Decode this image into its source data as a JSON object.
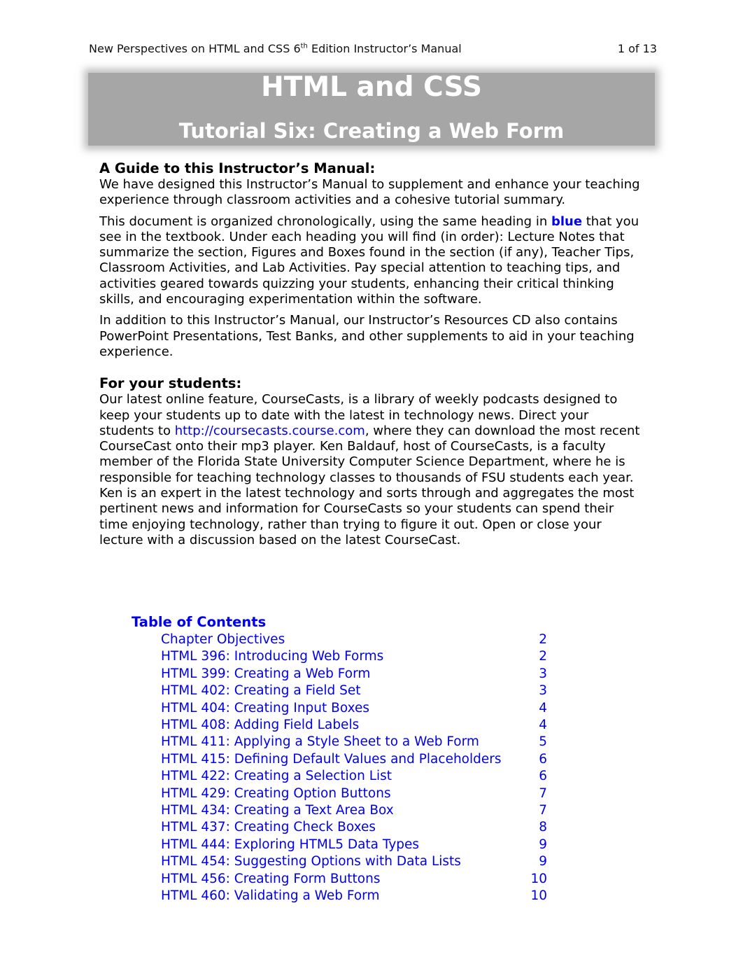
{
  "header": {
    "title_prefix": "New Perspectives on HTML and CSS 6",
    "title_sup": "th",
    "title_suffix": " Edition Instructor’s Manual",
    "page_indicator": "1 of 13"
  },
  "banner": {
    "title": "HTML and CSS",
    "subtitle": "Tutorial Six: Creating a Web Form"
  },
  "guide": {
    "heading": "A Guide to this Instructor’s Manual:",
    "para1": "We have designed this Instructor’s Manual to supplement and enhance your teaching experience through classroom activities and a cohesive tutorial summary.",
    "para2_before": "This document is organized chronologically, using the same heading in ",
    "para2_highlight": "blue",
    "para2_after": " that you see in the textbook. Under each heading you will find (in order): Lecture Notes that summarize the section, Figures and Boxes found in the section (if any), Teacher Tips, Classroom Activities, and Lab Activities. Pay special attention to teaching tips, and activities geared towards quizzing your students, enhancing their critical thinking skills, and encouraging experimentation within the software.",
    "para3": "In addition to this Instructor’s Manual, our Instructor’s Resources CD also contains PowerPoint Presentations, Test Banks, and other supplements to aid in your teaching experience."
  },
  "students": {
    "heading": "For your students:",
    "para_before": "Our latest online feature, CourseCasts, is a library of weekly podcasts designed to keep your students up to date with the latest in technology news. Direct your students to ",
    "link": "http://coursecasts.course.com",
    "para_after": ", where they can download the most recent CourseCast onto their mp3 player. Ken Baldauf, host of CourseCasts, is a faculty member of the Florida State University Computer Science Department, where he is responsible for teaching technology classes to thousands of FSU students each year. Ken is an expert in the latest technology and sorts through and aggregates the most pertinent news and information for CourseCasts so your students can spend their time enjoying technology, rather than trying to figure it out. Open or close your lecture with a discussion based on the latest CourseCast."
  },
  "toc": {
    "title": "Table of Contents",
    "items": [
      {
        "label": "Chapter Objectives",
        "page": "2"
      },
      {
        "label": "HTML 396: Introducing Web Forms",
        "page": "2"
      },
      {
        "label": "HTML 399: Creating a Web Form",
        "page": "3"
      },
      {
        "label": "HTML 402: Creating a Field Set",
        "page": "3"
      },
      {
        "label": "HTML 404: Creating Input Boxes",
        "page": "4"
      },
      {
        "label": "HTML 408: Adding Field Labels",
        "page": "4"
      },
      {
        "label": "HTML 411: Applying a Style Sheet to a Web Form",
        "page": "5"
      },
      {
        "label": "HTML 415: Defining Default Values and Placeholders",
        "page": "6"
      },
      {
        "label": "HTML 422: Creating a Selection List",
        "page": "6"
      },
      {
        "label": "HTML 429: Creating Option Buttons",
        "page": "7"
      },
      {
        "label": "HTML 434: Creating a Text Area Box",
        "page": "7"
      },
      {
        "label": "HTML 437: Creating Check Boxes",
        "page": "8"
      },
      {
        "label": "HTML 444: Exploring HTML5 Data Types",
        "page": "9"
      },
      {
        "label": "HTML 454: Suggesting Options with Data Lists",
        "page": "9"
      },
      {
        "label": "HTML 456: Creating Form Buttons",
        "page": "10"
      },
      {
        "label": "HTML 460: Validating a Web Form",
        "page": "10"
      }
    ]
  }
}
